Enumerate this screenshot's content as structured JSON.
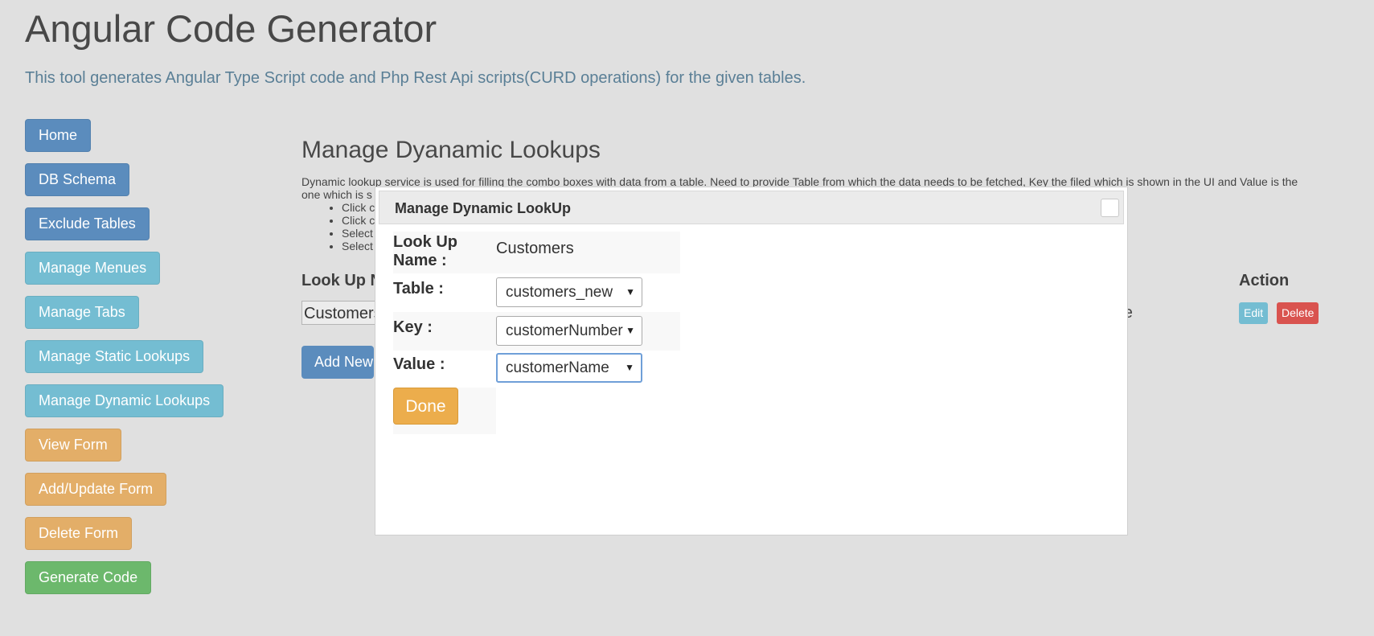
{
  "app": {
    "title": "Angular Code Generator",
    "subtitle": "This tool generates Angular Type Script code and Php Rest Api scripts(CURD operations) for the given tables."
  },
  "nav": {
    "items": [
      {
        "label": "Home",
        "style": "primary"
      },
      {
        "label": "DB Schema",
        "style": "primary"
      },
      {
        "label": "Exclude Tables",
        "style": "primary"
      },
      {
        "label": "Manage Menues",
        "style": "info"
      },
      {
        "label": "Manage Tabs",
        "style": "info"
      },
      {
        "label": "Manage Static Lookups",
        "style": "info"
      },
      {
        "label": "Manage Dynamic Lookups",
        "style": "info"
      },
      {
        "label": "View Form",
        "style": "warning"
      },
      {
        "label": "Add/Update Form",
        "style": "warning"
      },
      {
        "label": "Delete Form",
        "style": "warning"
      },
      {
        "label": "Generate Code",
        "style": "success"
      }
    ]
  },
  "main": {
    "title": "Manage Dyanamic Lookups",
    "description_line1": "Dynamic lookup service is used for filling the combo boxes with data from a table. Need to provide Table from which the data needs to be fetched, Key the filed which is shown in the UI and Value is the",
    "description_line2": "one which is s",
    "bullets": [
      "Click c",
      "Click c",
      "Select",
      "Select"
    ],
    "table": {
      "header_lookup": "Look Up N",
      "header_action": "Action",
      "row": {
        "lookup_value": "Customers",
        "value_partial": "ame",
        "edit_label": "Edit",
        "delete_label": "Delete"
      }
    },
    "add_new_label": "Add New"
  },
  "modal": {
    "title": "Manage Dynamic LookUp",
    "lookup_name_label": "Look Up Name :",
    "lookup_name_value": "Customers",
    "table_label": "Table :",
    "table_value": "customers_new",
    "key_label": "Key :",
    "key_value": "customerNumber",
    "value_label": "Value :",
    "value_value": "customerName",
    "done_label": "Done"
  },
  "colors": {
    "primary": "#5b8cbd",
    "info": "#74bdd2",
    "warning": "#e3ae68",
    "success": "#6cb86c",
    "danger": "#d9534f"
  }
}
